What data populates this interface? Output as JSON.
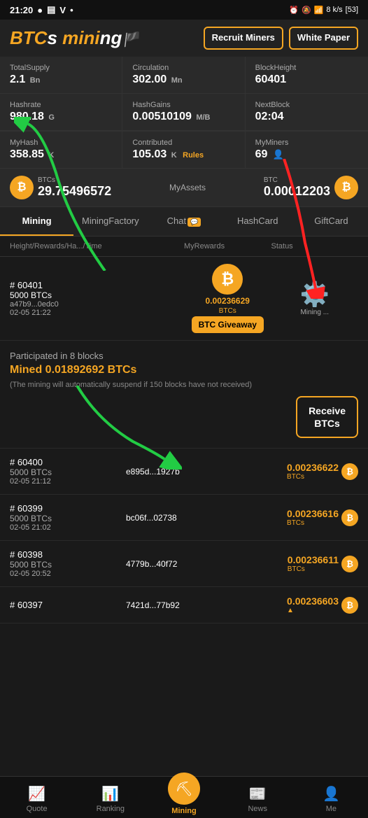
{
  "statusBar": {
    "time": "21:20",
    "icons": [
      "whatsapp",
      "message",
      "vpn",
      "dot"
    ],
    "rightIcons": [
      "alarm",
      "mute",
      "signal",
      "battery"
    ],
    "battery": "53",
    "speed": "8 k/s"
  },
  "header": {
    "logo": "BTCs mining",
    "recruitBtn": "Recruit Miners",
    "whitePaperBtn": "White Paper"
  },
  "stats": {
    "totalSupplyLabel": "TotalSupply",
    "totalSupplyValue": "2.1",
    "totalSupplyUnit": "Bn",
    "circulationLabel": "Circulation",
    "circulationValue": "302.00",
    "circulationUnit": "Mn",
    "blockHeightLabel": "BlockHeight",
    "blockHeightValue": "60401",
    "hashrateLabel": "Hashrate",
    "hashrateValue": "980.18",
    "hashrateUnit": "G",
    "hashGainsLabel": "HashGains",
    "hashGainsValue": "0.00510109",
    "hashGainsUnit": "M/B",
    "nextBlockLabel": "NextBlock",
    "nextBlockValue": "02:04"
  },
  "myStats": {
    "myHashLabel": "MyHash",
    "myHashValue": "358.85",
    "myHashUnit": "K",
    "contributedLabel": "Contributed",
    "contributedValue": "105.03",
    "contributedUnit": "K",
    "contributedRules": "Rules",
    "myMinersLabel": "MyMiners",
    "myMinersValue": "69"
  },
  "assets": {
    "btcsLabel": "BTCs",
    "btcsValue": "29.75496572",
    "myAssetsLabel": "MyAssets",
    "btcLabel": "BTC",
    "btcValue": "0.00012203"
  },
  "tabs": [
    {
      "id": "mining",
      "label": "Mining",
      "active": true
    },
    {
      "id": "miningfactory",
      "label": "MiningFactory",
      "active": false
    },
    {
      "id": "chat",
      "label": "Chat",
      "badge": "💬",
      "active": false
    },
    {
      "id": "hashcard",
      "label": "HashCard",
      "active": false
    },
    {
      "id": "giftcard",
      "label": "GiftCard",
      "active": false
    }
  ],
  "tableHeader": {
    "col1": "Height/Rewards/Ha.../Time",
    "col2": "MyRewards",
    "col3": "Status"
  },
  "currentBlock": {
    "id": "# 60401",
    "amount": "5000 BTCs",
    "hash": "a47b9...0edc0",
    "time": "02-05 21:22",
    "rewardValue": "0.00236629",
    "rewardLabel": "BTCs",
    "giveawayBtn": "BTC Giveaway",
    "statusLabel": "Mining ..."
  },
  "participatedBlock": {
    "title": "Participated in 8 blocks",
    "minedLabel": "Mined 0.01892692 BTCs",
    "note": "(The mining will automatically suspend if 150 blocks have not received)",
    "receiveBtn": "Receive BTCs"
  },
  "blocks": [
    {
      "id": "# 60400",
      "amount": "5000 BTCs",
      "hash": "e895d...1927b",
      "time": "02-05 21:12",
      "reward": "0.00236622",
      "rewardLabel": "BTCs"
    },
    {
      "id": "# 60399",
      "amount": "5000 BTCs",
      "hash": "bc06f...02738",
      "time": "02-05 21:02",
      "reward": "0.00236616",
      "rewardLabel": "BTCs"
    },
    {
      "id": "# 60398",
      "amount": "5000 BTCs",
      "hash": "4779b...40f72",
      "time": "02-05 20:52",
      "reward": "0.00236611",
      "rewardLabel": "BTCs"
    },
    {
      "id": "# 60397",
      "amount": "",
      "hash": "7421d...77b92",
      "time": "",
      "reward": "0.00236603",
      "rewardLabel": ""
    }
  ],
  "bottomNav": [
    {
      "id": "quote",
      "label": "Quote",
      "icon": "📈"
    },
    {
      "id": "ranking",
      "label": "Ranking",
      "icon": "📊"
    },
    {
      "id": "mining",
      "label": "Mining",
      "icon": "⛏",
      "center": true
    },
    {
      "id": "news",
      "label": "News",
      "icon": "📰"
    },
    {
      "id": "me",
      "label": "Me",
      "icon": "👤"
    }
  ]
}
